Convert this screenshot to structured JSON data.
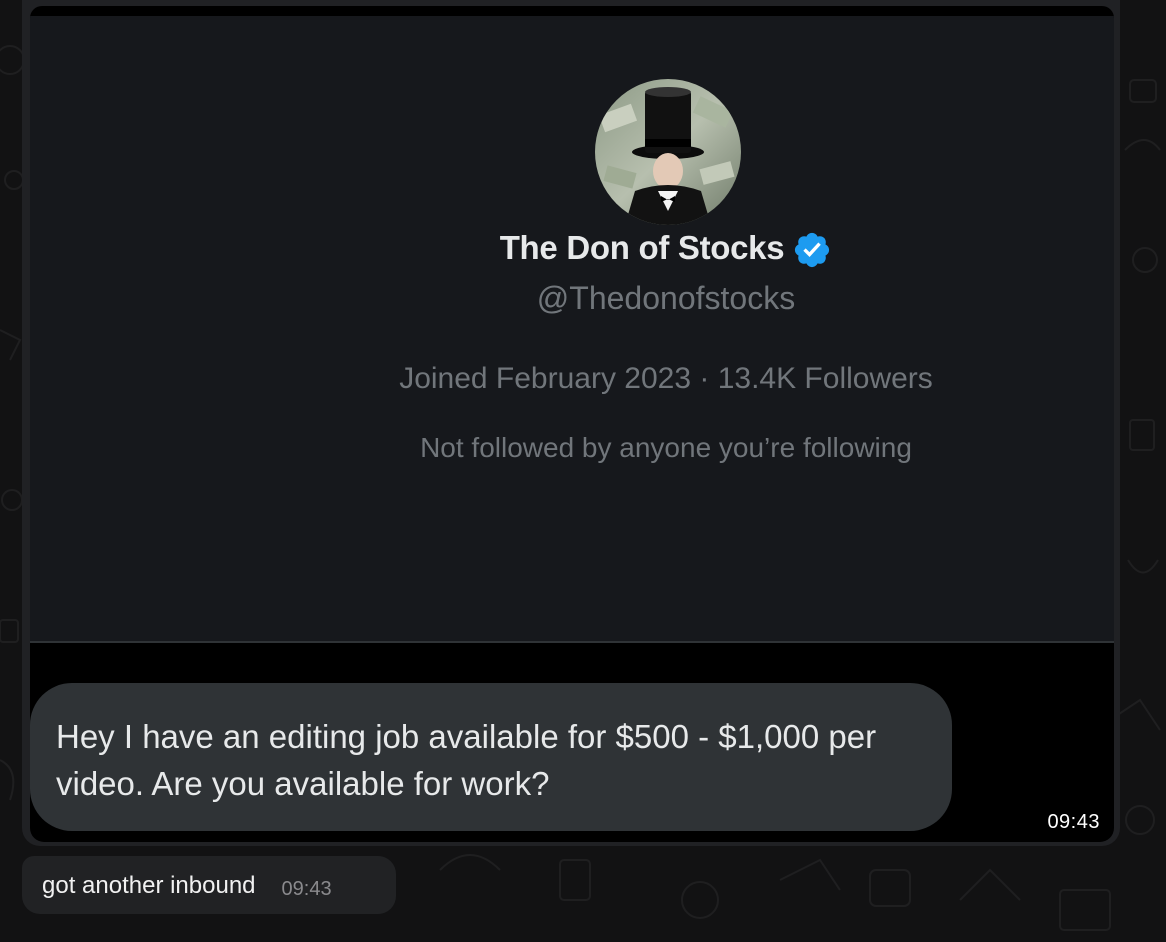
{
  "profile": {
    "display_name": "The Don of Stocks",
    "handle": "@Thedonofstocks",
    "joined_followers": "Joined February 2023 · 13.4K Followers",
    "not_followed": "Not followed by anyone you’re following",
    "verified_color": "#1d9bf0"
  },
  "dm": {
    "text": "Hey I have an editing job available for $500 - $1,000 per video. Are you available for work?",
    "time": "09:43"
  },
  "message": {
    "text": "got another inbound",
    "time": "09:43"
  }
}
